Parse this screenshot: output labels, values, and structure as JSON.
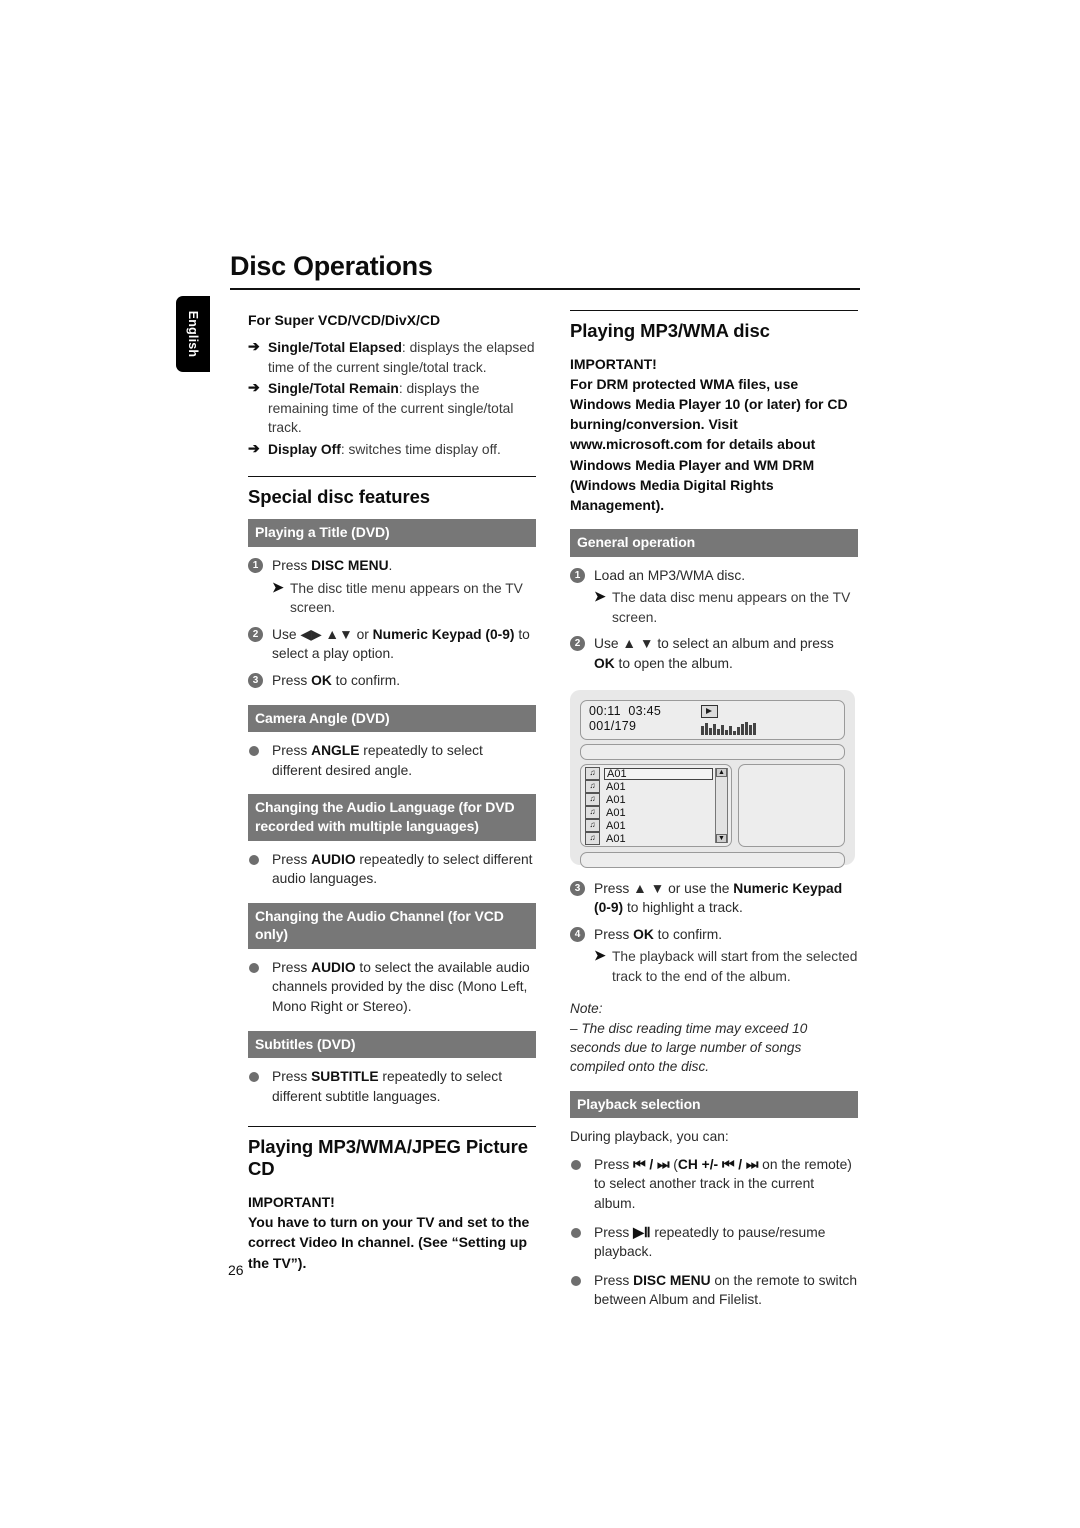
{
  "page": {
    "title": "Disc Operations",
    "language_tab": "English",
    "page_number": "26"
  },
  "left_column": {
    "intro": {
      "heading": "For Super VCD/VCD/DivX/CD",
      "items": [
        {
          "arrow": "➔",
          "term": "Single/Total Elapsed",
          "rest": ": displays the elapsed time of the current single/total track."
        },
        {
          "arrow": "➔",
          "term": "Single/Total Remain",
          "rest": ": displays the remaining time of the current single/total track."
        },
        {
          "arrow": "➔",
          "term": "Display Off",
          "rest": ": switches time display off."
        }
      ]
    },
    "special_features": {
      "heading": "Special disc features",
      "sections": [
        {
          "band": "Playing a Title (DVD)",
          "steps": [
            {
              "num": "1",
              "text_before": "Press ",
              "bold": "DISC MENU",
              "text_after": ".",
              "result": "The disc title menu appears on the TV screen."
            },
            {
              "num": "2",
              "text_before": "Use ◀▶ ▲▼   or ",
              "bold": "Numeric Keypad (0-9)",
              "text_after": " to select a play option.",
              "result": ""
            },
            {
              "num": "3",
              "text_before": "Press ",
              "bold": "OK",
              "text_after": " to confirm.",
              "result": ""
            }
          ]
        },
        {
          "band": "Camera Angle (DVD)",
          "bullets": [
            {
              "text_before": "Press ",
              "bold": "ANGLE",
              "text_after": " repeatedly to select different desired angle."
            }
          ]
        },
        {
          "band": "Changing the Audio Language (for DVD recorded with multiple languages)",
          "bullets": [
            {
              "text_before": "Press ",
              "bold": "AUDIO",
              "text_after": " repeatedly to select different audio languages."
            }
          ]
        },
        {
          "band": "Changing the Audio Channel  (for VCD only)",
          "bullets": [
            {
              "text_before": "Press ",
              "bold": "AUDIO",
              "text_after": " to select the available audio channels provided by the disc (Mono Left, Mono Right or Stereo)."
            }
          ]
        },
        {
          "band": "Subtitles (DVD)",
          "bullets": [
            {
              "text_before": "Press ",
              "bold": "SUBTITLE",
              "text_after": " repeatedly to select different subtitle languages."
            }
          ]
        }
      ]
    },
    "picture_cd": {
      "heading": "Playing MP3/WMA/JPEG Picture CD",
      "important_label": "IMPORTANT!",
      "important_text": "You have to turn on your TV and set to the correct Video In channel. (See “Setting up the TV”)."
    }
  },
  "right_column": {
    "mp3_wma": {
      "heading": "Playing MP3/WMA disc",
      "important_label": "IMPORTANT!",
      "important_text": "For DRM protected WMA files, use Windows Media Player 10 (or later) for CD burning/conversion. Visit www.microsoft.com for details about Windows Media Player and WM DRM (Windows Media Digital Rights Management)."
    },
    "general_operation": {
      "band": "General operation",
      "steps": [
        {
          "num": "1",
          "text_before": "Load an MP3/WMA disc.",
          "bold": "",
          "text_after": "",
          "result": "The data disc menu appears on the TV screen."
        },
        {
          "num": "2",
          "text_before": "Use ▲ ▼ to select an album and press ",
          "bold": "OK",
          "text_after": " to open the album.",
          "result": ""
        }
      ],
      "steps_after": [
        {
          "num": "3",
          "text_before": "Press ▲ ▼ or use the ",
          "bold": "Numeric Keypad (0-9)",
          "text_after": " to highlight a track.",
          "result": ""
        },
        {
          "num": "4",
          "text_before": "Press ",
          "bold": "OK",
          "text_after": " to confirm.",
          "result": "The playback will start from the selected track to the end of the album."
        }
      ],
      "note_label": "Note:",
      "note_text": "–   The disc reading time may exceed 10 seconds due to large number of songs compiled onto the disc."
    },
    "tv_screen": {
      "time_elapsed": "00:11",
      "time_total": "03:45",
      "track_counter": "001/179",
      "play_icon": "play-icon",
      "level_bars": [
        9,
        12,
        7,
        11,
        6,
        10,
        5,
        9,
        4,
        8,
        11,
        13,
        10,
        12
      ],
      "tracks": [
        "A01",
        "A01",
        "A01",
        "A01",
        "A01",
        "A01"
      ],
      "selected_index": 0,
      "scroll_up": "▲",
      "scroll_down": "▼",
      "track_icon": "music-note-icon"
    },
    "playback_selection": {
      "band": "Playback selection",
      "intro": "During playback, you can:",
      "bullets": [
        {
          "text_before": "Press ",
          "bold": "⏮ / ⏭",
          "mid": " (",
          "bold2": "CH +/- ⏮ / ⏭",
          "text_after": " on the remote) to select another track in the current album."
        },
        {
          "text_before": "Press ",
          "bold": "▶Ⅱ",
          "mid": "",
          "bold2": "",
          "text_after": " repeatedly to pause/resume playback."
        },
        {
          "text_before": "Press ",
          "bold": "DISC MENU",
          "mid": "",
          "bold2": "",
          "text_after": " on the remote to switch between Album and Filelist."
        }
      ]
    }
  }
}
